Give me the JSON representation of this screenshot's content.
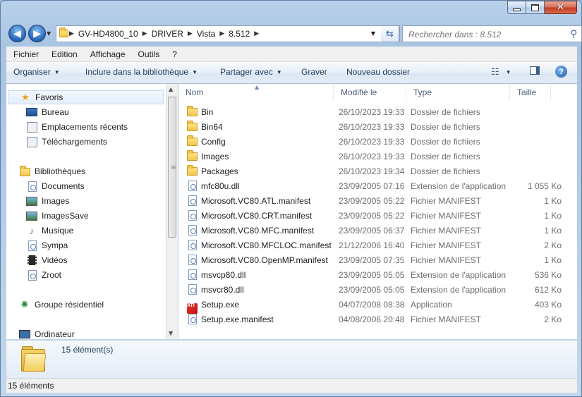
{
  "address": {
    "segments": [
      "GV-HD4800_10",
      "DRIVER",
      "Vista",
      "8.512"
    ]
  },
  "search": {
    "placeholder": "Rechercher dans : 8.512"
  },
  "menu": [
    "Fichier",
    "Edition",
    "Affichage",
    "Outils",
    "?"
  ],
  "toolbar": {
    "organize": "Organiser",
    "include": "Inclure dans la bibliothèque",
    "share": "Partager avec",
    "burn": "Graver",
    "new_folder": "Nouveau dossier"
  },
  "sidebar": {
    "favorites_label": "Favoris",
    "favorites": [
      "Bureau",
      "Emplacements récents",
      "Téléchargements"
    ],
    "libraries_label": "Bibliothèques",
    "libraries": [
      "Documents",
      "Images",
      "ImagesSave",
      "Musique",
      "Sympa",
      "Vidéos",
      "Zroot"
    ],
    "homegroup": "Groupe résidentiel",
    "computer": "Ordinateur"
  },
  "columns": {
    "name": "Nom",
    "modified": "Modifié le",
    "type": "Type",
    "size": "Taille"
  },
  "files": [
    {
      "name": "Bin",
      "date": "26/10/2023 19:33",
      "type": "Dossier de fichiers",
      "size": "",
      "icon": "folder-icon"
    },
    {
      "name": "Bin64",
      "date": "26/10/2023 19:33",
      "type": "Dossier de fichiers",
      "size": "",
      "icon": "folder-icon"
    },
    {
      "name": "Config",
      "date": "26/10/2023 19:33",
      "type": "Dossier de fichiers",
      "size": "",
      "icon": "folder-icon"
    },
    {
      "name": "Images",
      "date": "26/10/2023 19:33",
      "type": "Dossier de fichiers",
      "size": "",
      "icon": "folder-icon"
    },
    {
      "name": "Packages",
      "date": "26/10/2023 19:34",
      "type": "Dossier de fichiers",
      "size": "",
      "icon": "folder-icon"
    },
    {
      "name": "mfc80u.dll",
      "date": "23/09/2005 07:16",
      "type": "Extension de l'application",
      "size": "1 055 Ko",
      "icon": "dll-file-icon"
    },
    {
      "name": "Microsoft.VC80.ATL.manifest",
      "date": "23/09/2005 05:22",
      "type": "Fichier MANIFEST",
      "size": "1 Ko",
      "icon": "manifest-file-icon"
    },
    {
      "name": "Microsoft.VC80.CRT.manifest",
      "date": "23/09/2005 05:22",
      "type": "Fichier MANIFEST",
      "size": "1 Ko",
      "icon": "manifest-file-icon"
    },
    {
      "name": "Microsoft.VC80.MFC.manifest",
      "date": "23/09/2005 06:37",
      "type": "Fichier MANIFEST",
      "size": "1 Ko",
      "icon": "manifest-file-icon"
    },
    {
      "name": "Microsoft.VC80.MFCLOC.manifest",
      "date": "21/12/2006 16:40",
      "type": "Fichier MANIFEST",
      "size": "2 Ko",
      "icon": "manifest-file-icon"
    },
    {
      "name": "Microsoft.VC80.OpenMP.manifest",
      "date": "23/09/2005 07:35",
      "type": "Fichier MANIFEST",
      "size": "1 Ko",
      "icon": "manifest-file-icon"
    },
    {
      "name": "msvcp80.dll",
      "date": "23/09/2005 05:05",
      "type": "Extension de l'application",
      "size": "536 Ko",
      "icon": "dll-file-icon"
    },
    {
      "name": "msvcr80.dll",
      "date": "23/09/2005 05:05",
      "type": "Extension de l'application",
      "size": "612 Ko",
      "icon": "dll-file-icon"
    },
    {
      "name": "Setup.exe",
      "date": "04/07/2008 08:38",
      "type": "Application",
      "size": "403 Ko",
      "icon": "setup-app-icon"
    },
    {
      "name": "Setup.exe.manifest",
      "date": "04/08/2006 20:48",
      "type": "Fichier MANIFEST",
      "size": "2 Ko",
      "icon": "manifest-file-icon"
    }
  ],
  "details": {
    "count": "15 élément(s)"
  },
  "status": {
    "text": "15 éléments"
  }
}
